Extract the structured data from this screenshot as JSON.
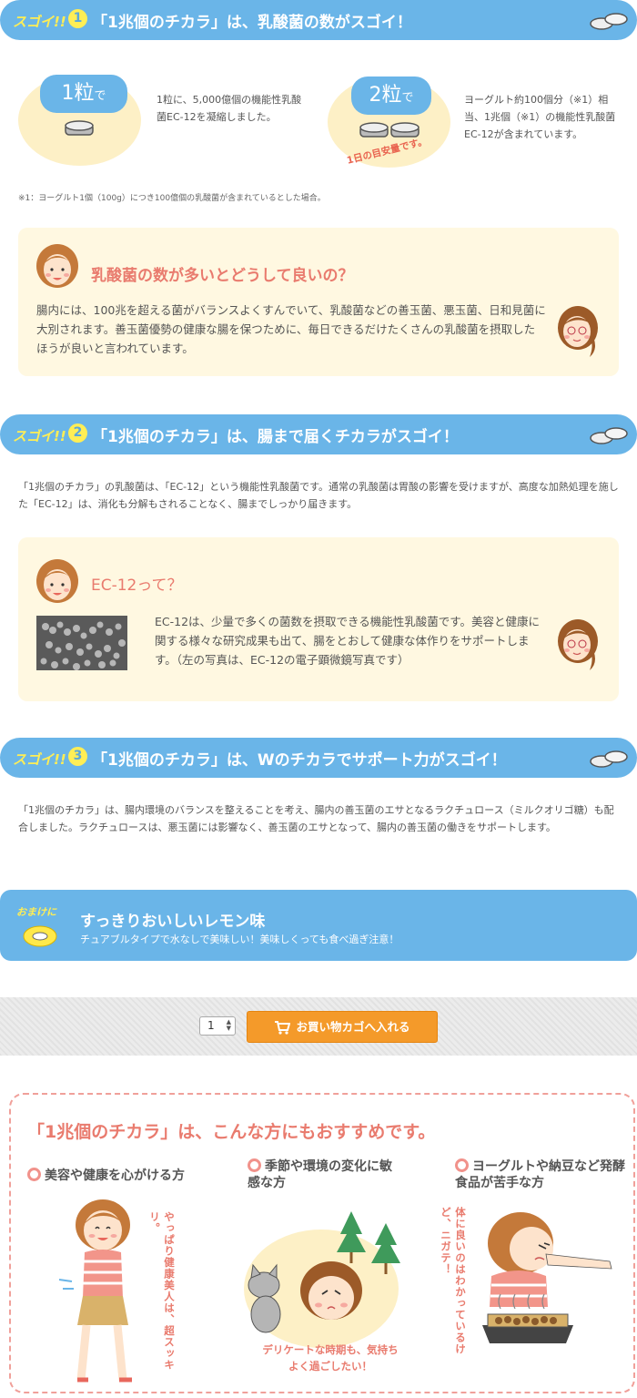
{
  "section1": {
    "sugoi": "スゴイ!!",
    "num": "1",
    "title": "「1兆個のチカラ」は、乳酸菌の数がスゴイ！",
    "left_tag_big": "1粒",
    "left_tag_small": "で",
    "left_text": "1粒に、5,000億個の機能性乳酸菌EC-12を凝縮しました。",
    "right_tag_big": "2粒",
    "right_tag_small": "で",
    "right_curve": "1日の目安量です。",
    "right_text": "ヨーグルト約100個分（※1）相当、1兆個（※1）の機能性乳酸菌EC-12が含まれています。",
    "note": "※1：ヨーグルト1個（100g）につき100億個の乳酸菌が含まれているとした場合。"
  },
  "q1": {
    "title": "乳酸菌の数が多いとどうして良いの？",
    "text": "腸内には、100兆を超える菌がバランスよくすんでいて、乳酸菌などの善玉菌、悪玉菌、日和見菌に大別されます。善玉菌優勢の健康な腸を保つために、毎日できるだけたくさんの乳酸菌を摂取したほうが良いと言われています。"
  },
  "section2": {
    "sugoi": "スゴイ!!",
    "num": "2",
    "title": "「1兆個のチカラ」は、腸まで届くチカラがスゴイ！",
    "text": "「1兆個のチカラ」の乳酸菌は、「EC-12」という機能性乳酸菌です。通常の乳酸菌は胃酸の影響を受けますが、高度な加熱処理を施した「EC-12」は、消化も分解もされることなく、腸までしっかり届きます。"
  },
  "q2": {
    "title": "EC-12って？",
    "text": "EC-12は、少量で多くの菌数を摂取できる機能性乳酸菌です。美容と健康に関する様々な研究成果も出て、腸をとおして健康な体作りをサポートします。（左の写真は、EC-12の電子顕微鏡写真です）"
  },
  "section3": {
    "sugoi": "スゴイ!!",
    "num": "3",
    "title": "「1兆個のチカラ」は、Wのチカラでサポート力がスゴイ！",
    "text": "「1兆個のチカラ」は、腸内環境のバランスを整えることを考え、腸内の善玉菌のエサとなるラクチュロース（ミルクオリゴ糖）も配合しました。ラクチュロースは、悪玉菌には影響なく、善玉菌のエサとなって、腸内の善玉菌の働きをサポートします。"
  },
  "omake": {
    "label": "おまけに",
    "title": "すっきりおいしいレモン味",
    "sub": "チュアブルタイプで水なしで美味しい！美味しくっても食べ過ぎ注意！"
  },
  "cart": {
    "quantity": "1",
    "button": "お買い物カゴへ入れる"
  },
  "recommend": {
    "title": "「1兆個のチカラ」は、こんな方にもおすすめです。",
    "items": [
      {
        "heading": "美容や健康を心がける方",
        "caption": "やっぱり健康美人は、超スッキリ。"
      },
      {
        "heading": "季節や環境の変化に敏感な方",
        "caption": "デリケートな時期も、気持ちよく過ごしたい！"
      },
      {
        "heading": "ヨーグルトや納豆など発酵食品が苦手な方",
        "caption": "体に良いのはわかっているけど、ニガテ！"
      }
    ]
  },
  "colors": {
    "header_blue": "#6ab5e8",
    "accent_yellow": "#ffee55",
    "title_coral": "#e97b6e",
    "box_cream": "#fff8e1",
    "cart_orange": "#f49a2a"
  }
}
